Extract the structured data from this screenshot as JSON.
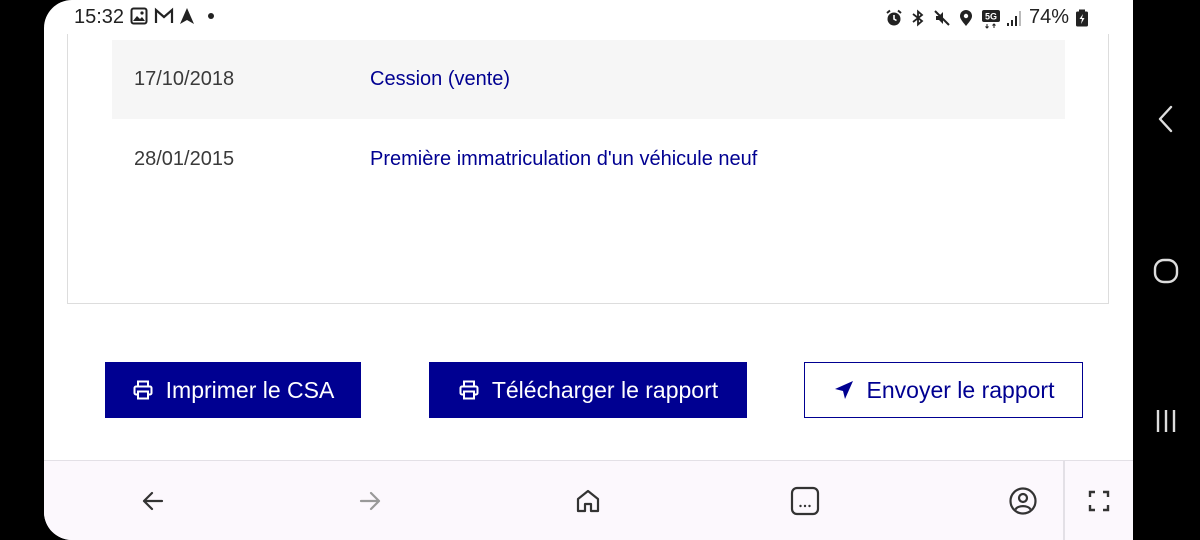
{
  "status_bar": {
    "time": "15:32",
    "battery": "74%",
    "network": "5G",
    "left_icons": [
      "gallery-icon",
      "gmail-icon",
      "navigation-icon",
      "dot-icon"
    ],
    "right_icons": [
      "alarm-icon",
      "bluetooth-icon",
      "mute-icon",
      "location-icon",
      "network-5g-icon",
      "signal-icon",
      "battery-icon"
    ]
  },
  "history": {
    "rows": [
      {
        "date": "17/10/2018",
        "event": "Cession (vente)"
      },
      {
        "date": "28/01/2015",
        "event": "Première immatriculation d'un véhicule neuf"
      }
    ]
  },
  "actions": {
    "print_label": "Imprimer le CSA",
    "download_label": "Télécharger le rapport",
    "send_label": "Envoyer le rapport"
  },
  "colors": {
    "primary": "#000091",
    "row_shade": "#f6f6f6",
    "toolbar_bg": "#fcf8fd"
  },
  "browser_toolbar": {
    "items": [
      "back-icon",
      "forward-icon",
      "home-icon",
      "tabs-icon",
      "profile-icon",
      "fullscreen-icon"
    ]
  },
  "system_nav": {
    "items": [
      "nav-back-icon",
      "nav-home-icon",
      "nav-recents-icon"
    ]
  }
}
